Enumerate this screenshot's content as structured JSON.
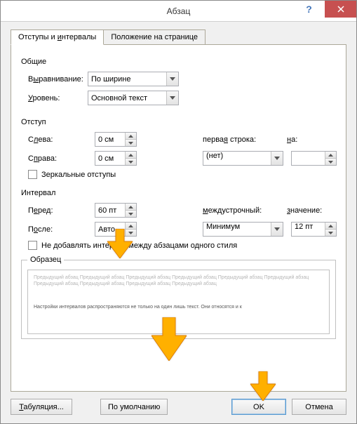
{
  "title": "Абзац",
  "tabs": {
    "indent": "Отступы и интервалы",
    "pos": "Положение на странице"
  },
  "general": {
    "title": "Общие",
    "align_label": "Выравнивание:",
    "align_value": "По ширине",
    "outline_label": "Уровень:",
    "outline_value": "Основной текст"
  },
  "indent": {
    "title": "Отступ",
    "left_label": "Слева:",
    "left_value": "0 см",
    "right_label": "Справа:",
    "right_value": "0 см",
    "firstline_label": "первая строка:",
    "firstline_value": "(нет)",
    "by_label": "на:",
    "by_value": "",
    "mirror": "Зеркальные отступы"
  },
  "spacing": {
    "title": "Интервал",
    "before_label": "Перед:",
    "before_value": "60 пт",
    "after_label": "После:",
    "after_value": "Авто",
    "line_label": "междустрочный:",
    "line_value": "Минимум",
    "at_label": "значение:",
    "at_value": "12 пт",
    "no_add": "Не добавлять интервал между абзацами одного стиля"
  },
  "preview": {
    "title": "Образец",
    "gray": "Предыдущий абзац Предыдущий абзац Предыдущий абзац Предыдущий абзац Предыдущий абзац Предыдущий абзац Предыдущий абзац Предыдущий абзац Предыдущий абзац Предыдущий абзац",
    "dark": "Настройки интервалов распространяются не только на один лишь текст. Они относятся и к"
  },
  "buttons": {
    "tabs": "Табуляция...",
    "default": "По умолчанию",
    "ok": "OK",
    "cancel": "Отмена"
  }
}
